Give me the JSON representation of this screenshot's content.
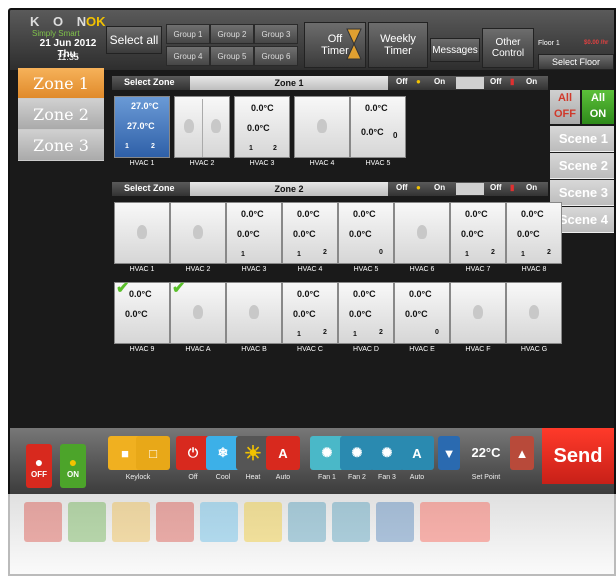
{
  "brand": {
    "logo": "K O N",
    "ok": "OK",
    "tagline": "Simply Smart",
    "date": "21 Jun 2012 Thu,",
    "time": "11:35"
  },
  "topbar": {
    "select_all": "Select all",
    "groups": [
      "Group 1",
      "Group 2",
      "Group 3",
      "Group 4",
      "Group 5",
      "Group 6"
    ],
    "off_timer": [
      "Off",
      "Timer"
    ],
    "weekly_timer": [
      "Weekly",
      "Timer"
    ],
    "messages": "Messages",
    "other_control": [
      "Other",
      "Control"
    ],
    "floor": "Floor 1",
    "price": "$0.00 /hr",
    "select_floor": "Select Floor"
  },
  "zones": [
    "Zone 1",
    "Zone 2",
    "Zone 3"
  ],
  "panels": [
    {
      "select_zone": "Select Zone",
      "zone": "Zone 1",
      "off": "Off",
      "on": "On",
      "off2": "Off",
      "on2": "On"
    },
    {
      "select_zone": "Select Zone",
      "zone": "Zone 2",
      "off": "Off",
      "on": "On",
      "off2": "Off",
      "on2": "On"
    }
  ],
  "zone1_tiles": [
    {
      "label": "HVAC 1",
      "t1": "27.0°C",
      "t2": "27.0°C",
      "fan": "1",
      "set": "2"
    },
    {
      "label": "HVAC 2"
    },
    {
      "label": "HVAC 3",
      "t1": "0.0°C",
      "t2": "0.0°C",
      "fan": "1",
      "set": "2"
    },
    {
      "label": "HVAC 4"
    },
    {
      "label": "HVAC 5",
      "t1": "0.0°C",
      "t2": "0.0°C",
      "set": "0"
    }
  ],
  "zone2_row1": [
    {
      "label": "HVAC 1"
    },
    {
      "label": "HVAC 2"
    },
    {
      "label": "HVAC 3",
      "t1": "0.0°C",
      "t2": "0.0°C",
      "fan": "1"
    },
    {
      "label": "HVAC 4",
      "t1": "0.0°C",
      "t2": "0.0°C",
      "fan": "1",
      "set": "2"
    },
    {
      "label": "HVAC 5",
      "t1": "0.0°C",
      "t2": "0.0°C",
      "set": "0"
    },
    {
      "label": "HVAC 6"
    },
    {
      "label": "HVAC 7",
      "t1": "0.0°C",
      "t2": "0.0°C",
      "fan": "1",
      "set": "2"
    },
    {
      "label": "HVAC 8",
      "t1": "0.0°C",
      "t2": "0.0°C",
      "fan": "1",
      "set": "2"
    }
  ],
  "zone2_row2": [
    {
      "label": "HVAC 9",
      "t1": "0.0°C",
      "t2": "0.0°C"
    },
    {
      "label": "HVAC A"
    },
    {
      "label": "HVAC B"
    },
    {
      "label": "HVAC C",
      "t1": "0.0°C",
      "t2": "0.0°C",
      "fan": "1",
      "set": "2"
    },
    {
      "label": "HVAC D",
      "t1": "0.0°C",
      "t2": "0.0°C",
      "fan": "1",
      "set": "2"
    },
    {
      "label": "HVAC E",
      "t1": "0.0°C",
      "t2": "0.0°C",
      "set": "0"
    },
    {
      "label": "HVAC F"
    },
    {
      "label": "HVAC G"
    }
  ],
  "scenes": {
    "all_off": [
      "All",
      "OFF"
    ],
    "all_on": [
      "All",
      "ON"
    ],
    "list": [
      "Scene 1",
      "Scene 2",
      "Scene 3",
      "Scene 4"
    ]
  },
  "bottom": {
    "light_off": "OFF",
    "light_on": "ON",
    "keylock": "Keylock",
    "off": "Off",
    "cool": "Cool",
    "heat": "Heat",
    "auto": "Auto",
    "fan1": "Fan 1",
    "fan2": "Fan 2",
    "fan3": "Fan 3",
    "fan_auto": "Auto",
    "set_point_value": "22°C",
    "set_point": "Set Point",
    "send": "Send"
  },
  "colors": {
    "accent_orange": "#f0a040",
    "all_off": "#d0392b",
    "all_on": "#4caf2a",
    "send": "#e0302a",
    "cool": "#3cb0e8"
  }
}
